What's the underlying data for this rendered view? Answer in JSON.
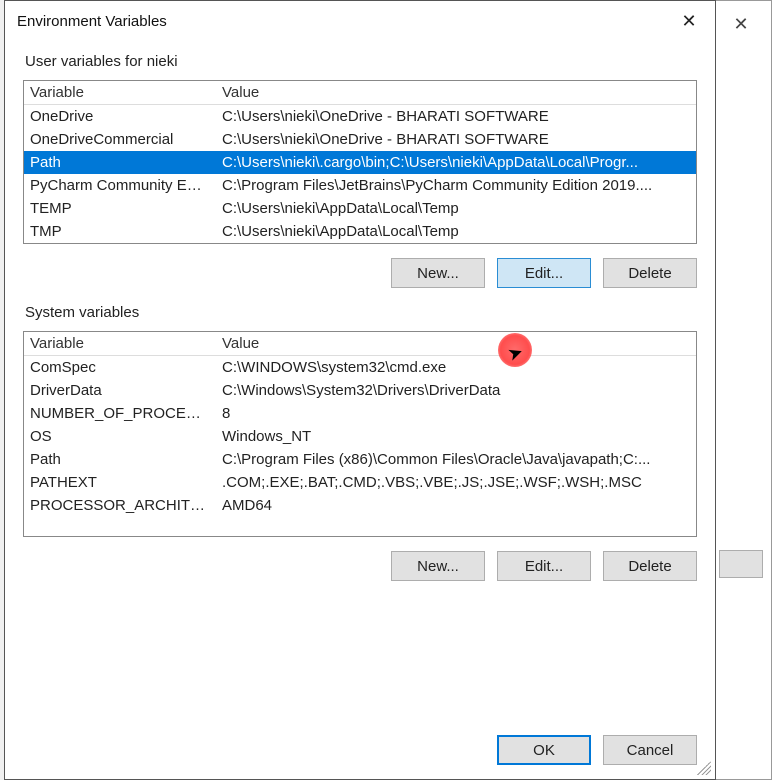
{
  "title": "Environment Variables",
  "user_group_label": "User variables for nieki",
  "system_group_label": "System variables",
  "columns": {
    "variable": "Variable",
    "value": "Value"
  },
  "user_vars": [
    {
      "name": "OneDrive",
      "value": "C:\\Users\\nieki\\OneDrive - BHARATI SOFTWARE",
      "selected": false
    },
    {
      "name": "OneDriveCommercial",
      "value": "C:\\Users\\nieki\\OneDrive - BHARATI SOFTWARE",
      "selected": false
    },
    {
      "name": "Path",
      "value": "C:\\Users\\nieki\\.cargo\\bin;C:\\Users\\nieki\\AppData\\Local\\Progr...",
      "selected": true
    },
    {
      "name": "PyCharm Community Editi...",
      "value": "C:\\Program Files\\JetBrains\\PyCharm Community Edition 2019....",
      "selected": false
    },
    {
      "name": "TEMP",
      "value": "C:\\Users\\nieki\\AppData\\Local\\Temp",
      "selected": false
    },
    {
      "name": "TMP",
      "value": "C:\\Users\\nieki\\AppData\\Local\\Temp",
      "selected": false
    }
  ],
  "system_vars": [
    {
      "name": "ComSpec",
      "value": "C:\\WINDOWS\\system32\\cmd.exe"
    },
    {
      "name": "DriverData",
      "value": "C:\\Windows\\System32\\Drivers\\DriverData"
    },
    {
      "name": "NUMBER_OF_PROCESSORS",
      "value": "8"
    },
    {
      "name": "OS",
      "value": "Windows_NT"
    },
    {
      "name": "Path",
      "value": "C:\\Program Files (x86)\\Common Files\\Oracle\\Java\\javapath;C:..."
    },
    {
      "name": "PATHEXT",
      "value": ".COM;.EXE;.BAT;.CMD;.VBS;.VBE;.JS;.JSE;.WSF;.WSH;.MSC"
    },
    {
      "name": "PROCESSOR_ARCHITECTU...",
      "value": "AMD64"
    }
  ],
  "buttons": {
    "new": "New...",
    "edit": "Edit...",
    "delete": "Delete",
    "ok": "OK",
    "cancel": "Cancel"
  }
}
